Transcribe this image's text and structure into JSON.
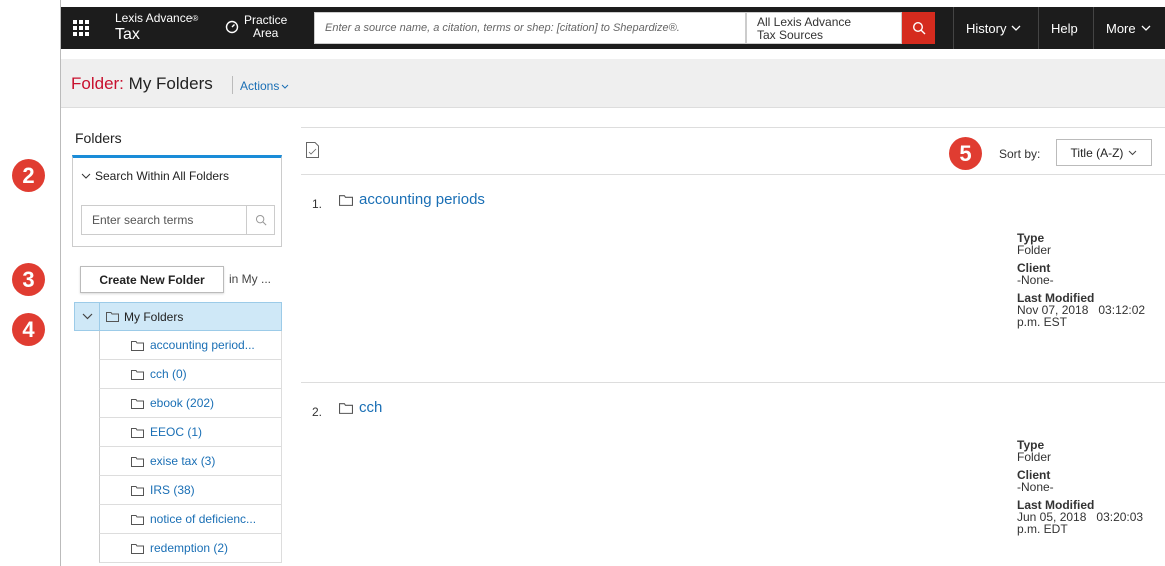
{
  "topbar": {
    "brand_line1": "Lexis Advance",
    "brand_reg": "®",
    "brand_line2": "Tax",
    "practice_line1": "Practice",
    "practice_line2": "Area",
    "search_placeholder": "Enter a source name, a citation, terms or shep: [citation] to Shepardize®.",
    "scope_line1": "All Lexis Advance",
    "scope_line2": "Tax Sources",
    "history_label": "History",
    "help_label": "Help",
    "more_label": "More"
  },
  "header": {
    "folder_prefix": "Folder:",
    "folder_name": "My Folders",
    "actions_label": "Actions"
  },
  "sidebar": {
    "folders_label": "Folders",
    "search_title": "Search Within All Folders",
    "search_placeholder": "Enter search terms",
    "create_button": "Create New Folder",
    "in_my": "in My ...",
    "root_label": "My Folders",
    "items": [
      {
        "label": "accounting period..."
      },
      {
        "label": "cch (0)"
      },
      {
        "label": "ebook (202)"
      },
      {
        "label": "EEOC (1)"
      },
      {
        "label": "exise tax (3)"
      },
      {
        "label": "IRS (38)"
      },
      {
        "label": "notice of deficienc..."
      },
      {
        "label": "redemption (2)"
      }
    ]
  },
  "main": {
    "sort_label": "Sort by:",
    "sort_value": "Title (A-Z)",
    "results": [
      {
        "num": "1.",
        "title": "accounting periods",
        "type_label": "Type",
        "type_value": "Folder",
        "client_label": "Client",
        "client_value": "-None-",
        "modified_label": "Last Modified",
        "modified_value": "Nov 07, 2018   03:12:02",
        "modified_tz": "p.m. EST"
      },
      {
        "num": "2.",
        "title": "cch",
        "type_label": "Type",
        "type_value": "Folder",
        "client_label": "Client",
        "client_value": "-None-",
        "modified_label": "Last Modified",
        "modified_value": "Jun 05, 2018   03:20:03",
        "modified_tz": "p.m. EDT"
      }
    ]
  },
  "callouts": [
    "2",
    "3",
    "4",
    "5"
  ],
  "colors": {
    "accent_red": "#e03c31",
    "link_blue": "#1a6fb5",
    "topbar_bg": "#1c1c1c"
  }
}
